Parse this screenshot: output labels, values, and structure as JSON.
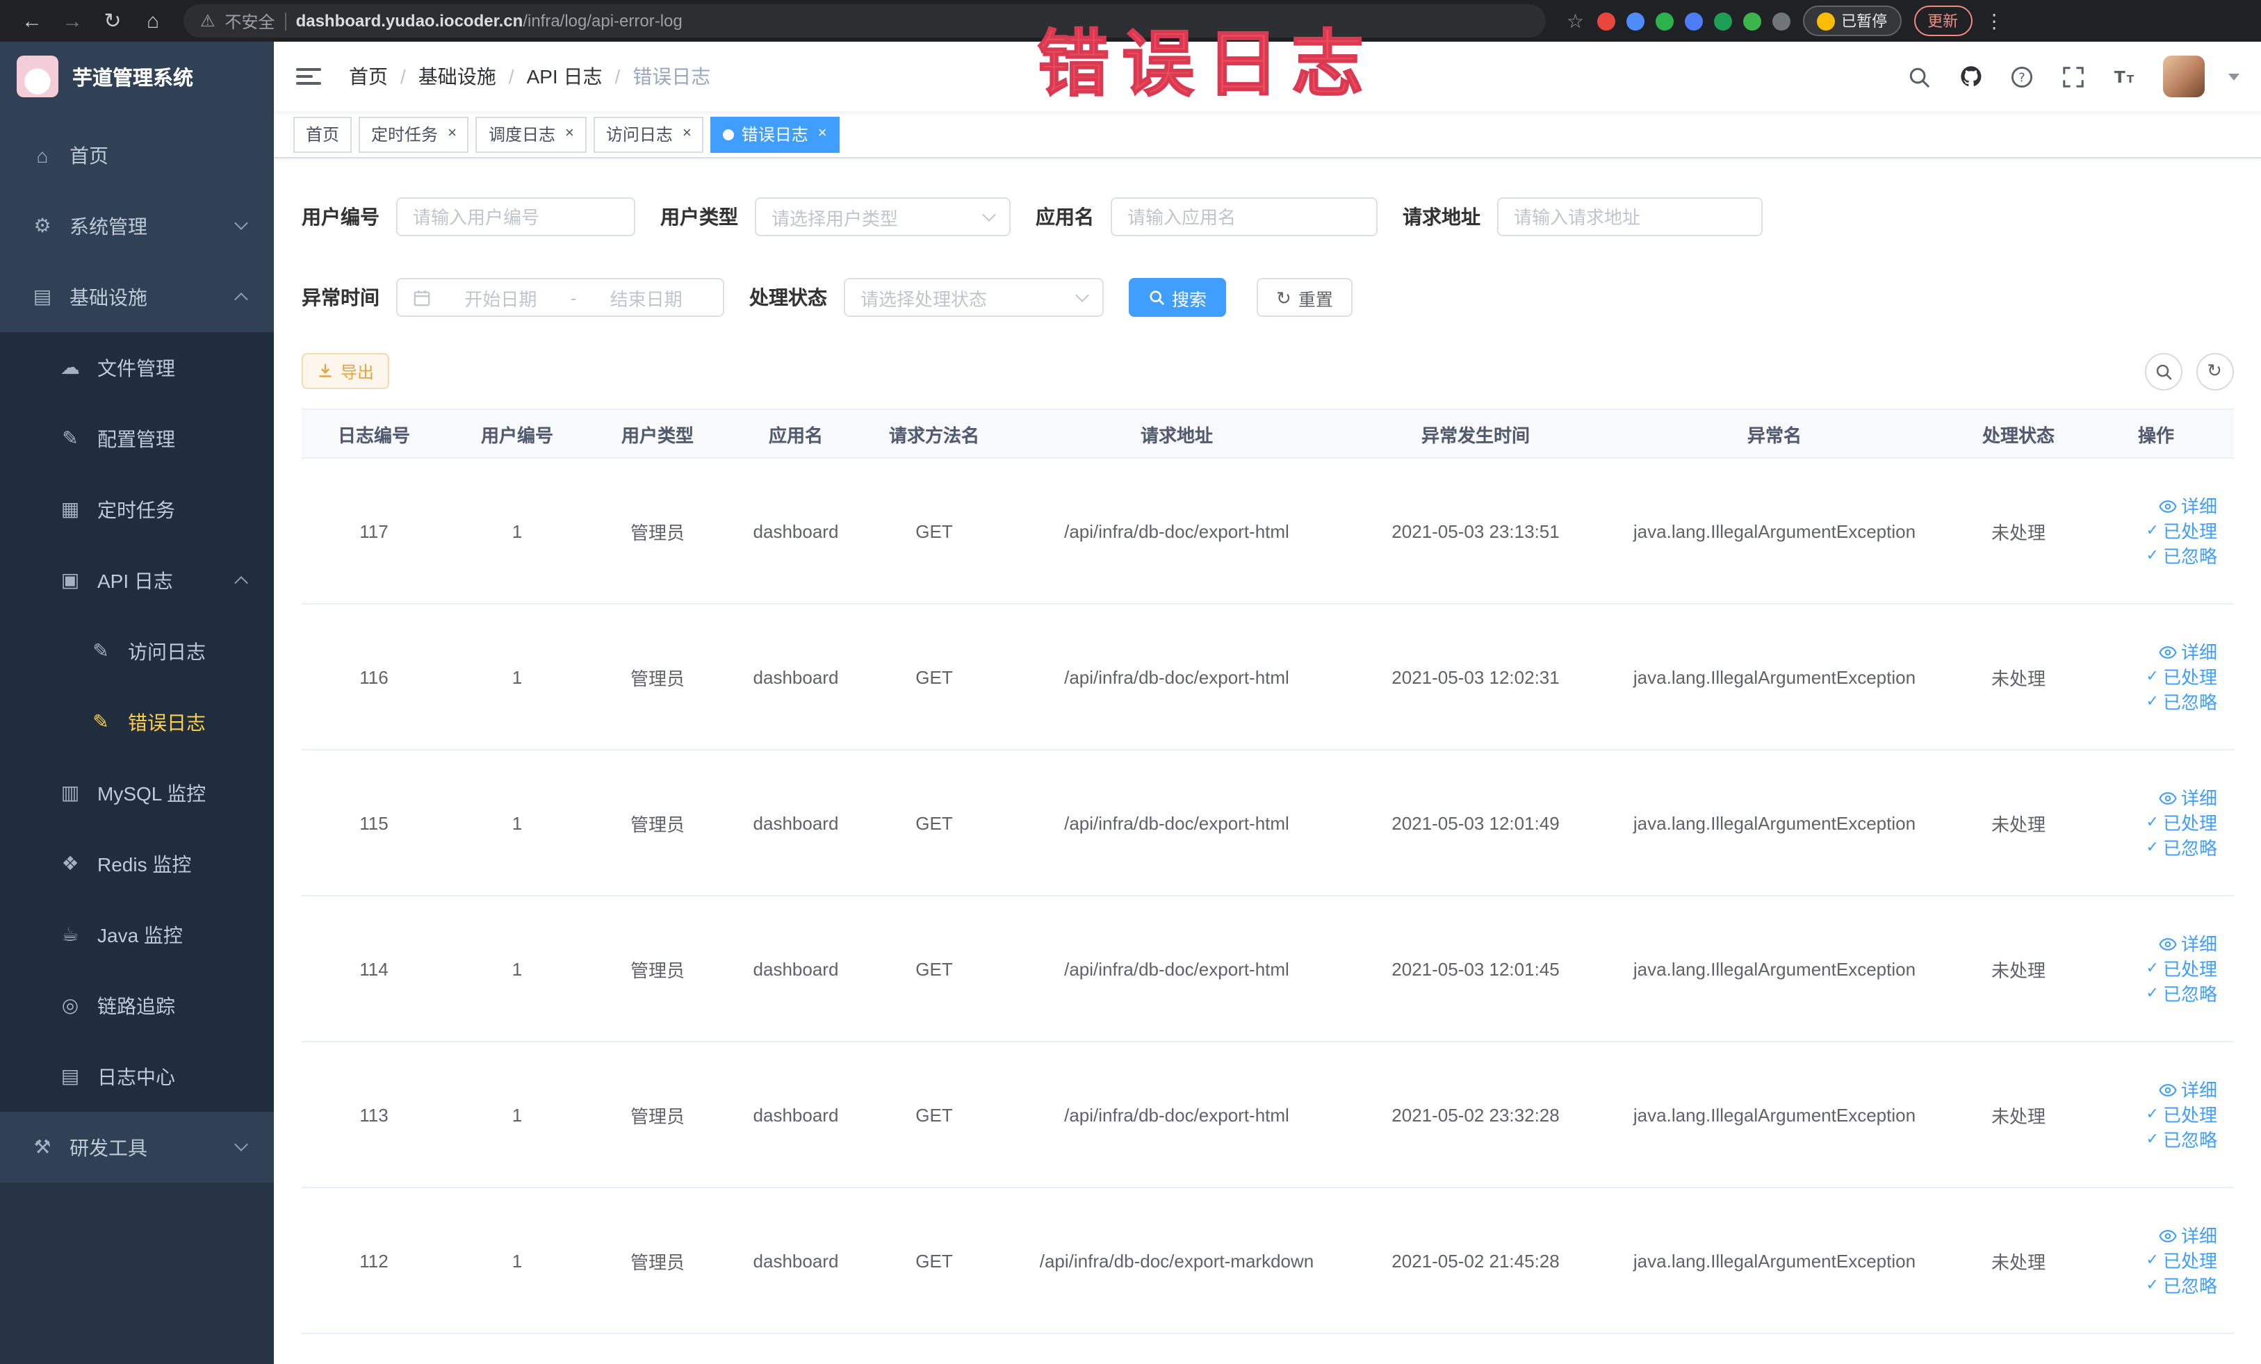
{
  "theme": {
    "primary": "#409eff",
    "menu_active": "#ffd04b",
    "sidebar_bg": "#304156",
    "submenu_bg": "#1f2d3d",
    "sidebar_bottom": "#263445",
    "warning_text": "#e6a23c",
    "warning_bg": "#fdf6ec",
    "warning_border": "#f5dab1",
    "annotation": "#ef4b5f"
  },
  "browser": {
    "security_label": "不安全",
    "url_host": "dashboard.yudao.iocoder.cn",
    "url_path": "/infra/log/api-error-log",
    "paused_label": "已暂停",
    "update_label": "更新",
    "extension_colors": [
      "#e8453c",
      "#4e8cf9",
      "#2bb24c",
      "#4e7df9",
      "#1e9e55",
      "#3cb54a",
      "#70757a"
    ]
  },
  "annotation": {
    "text": "错误日志"
  },
  "sidebar": {
    "title": "芋道管理系统",
    "items": [
      {
        "name": "home",
        "label": "首页",
        "icon": "home-icon",
        "level": 0,
        "chevron": "none",
        "active": false
      },
      {
        "name": "system-mgmt",
        "label": "系统管理",
        "icon": "gear-icon",
        "level": 0,
        "chevron": "down",
        "active": false
      },
      {
        "name": "infrastructure",
        "label": "基础设施",
        "icon": "infra-icon",
        "level": 0,
        "chevron": "up",
        "active": false
      },
      {
        "name": "file-mgmt",
        "label": "文件管理",
        "icon": "file-icon",
        "level": 1,
        "chevron": "none",
        "active": false
      },
      {
        "name": "config-mgmt",
        "label": "配置管理",
        "icon": "config-icon",
        "level": 1,
        "chevron": "none",
        "active": false
      },
      {
        "name": "scheduled-jobs",
        "label": "定时任务",
        "icon": "timer-icon",
        "level": 1,
        "chevron": "none",
        "active": false
      },
      {
        "name": "api-log",
        "label": "API 日志",
        "icon": "api-log-icon",
        "level": 1,
        "chevron": "up",
        "active": false
      },
      {
        "name": "access-log",
        "label": "访问日志",
        "icon": "access-log-icon",
        "level": 2,
        "chevron": "none",
        "active": false
      },
      {
        "name": "error-log",
        "label": "错误日志",
        "icon": "error-log-icon",
        "level": 2,
        "chevron": "none",
        "active": true
      },
      {
        "name": "mysql-monitor",
        "label": "MySQL 监控",
        "icon": "mysql-icon",
        "level": 1,
        "chevron": "none",
        "active": false
      },
      {
        "name": "redis-monitor",
        "label": "Redis 监控",
        "icon": "redis-icon",
        "level": 1,
        "chevron": "none",
        "active": false
      },
      {
        "name": "java-monitor",
        "label": "Java 监控",
        "icon": "java-icon",
        "level": 1,
        "chevron": "none",
        "active": false
      },
      {
        "name": "link-trace",
        "label": "链路追踪",
        "icon": "trace-icon",
        "level": 1,
        "chevron": "none",
        "active": false
      },
      {
        "name": "log-center",
        "label": "日志中心",
        "icon": "log-center-icon",
        "level": 1,
        "chevron": "none",
        "active": false
      },
      {
        "name": "dev-tools",
        "label": "研发工具",
        "icon": "tools-icon",
        "level": 0,
        "chevron": "down",
        "active": false
      }
    ]
  },
  "icon_glyphs": {
    "home-icon": "⌂",
    "gear-icon": "⚙",
    "infra-icon": "▤",
    "file-icon": "☁",
    "config-icon": "✎",
    "timer-icon": "▦",
    "api-log-icon": "▣",
    "access-log-icon": "✎",
    "error-log-icon": "✎",
    "mysql-icon": "▥",
    "redis-icon": "❖",
    "java-icon": "☕",
    "trace-icon": "◎",
    "log-center-icon": "▤",
    "tools-icon": "⚒"
  },
  "breadcrumb": [
    "首页",
    "基础设施",
    "API 日志",
    "错误日志"
  ],
  "tabs": [
    {
      "label": "首页",
      "closable": false,
      "active": false
    },
    {
      "label": "定时任务",
      "closable": true,
      "active": false
    },
    {
      "label": "调度日志",
      "closable": true,
      "active": false
    },
    {
      "label": "访问日志",
      "closable": true,
      "active": false
    },
    {
      "label": "错误日志",
      "closable": true,
      "active": true
    }
  ],
  "filters": {
    "user_id_label": "用户编号",
    "user_id_placeholder": "请输入用户编号",
    "user_type_label": "用户类型",
    "user_type_placeholder": "请选择用户类型",
    "app_name_label": "应用名",
    "app_name_placeholder": "请输入应用名",
    "request_url_label": "请求地址",
    "request_url_placeholder": "请输入请求地址",
    "exception_time_label": "异常时间",
    "date_start_placeholder": "开始日期",
    "date_separator": "-",
    "date_end_placeholder": "结束日期",
    "process_status_label": "处理状态",
    "process_status_placeholder": "请选择处理状态",
    "search_label": "搜索",
    "reset_label": "重置"
  },
  "toolbar": {
    "export_label": "导出"
  },
  "table": {
    "columns": [
      "日志编号",
      "用户编号",
      "用户类型",
      "应用名",
      "请求方法名",
      "请求地址",
      "异常发生时间",
      "异常名",
      "处理状态",
      "操作"
    ],
    "actions": [
      "详细",
      "已处理",
      "已忽略"
    ],
    "rows": [
      {
        "id": "117",
        "user_id": "1",
        "user_type": "管理员",
        "app": "dashboard",
        "method": "GET",
        "url": "/api/infra/db-doc/export-html",
        "time": "2021-05-03 23:13:51",
        "exception": "java.lang.IllegalArgumentException",
        "status": "未处理"
      },
      {
        "id": "116",
        "user_id": "1",
        "user_type": "管理员",
        "app": "dashboard",
        "method": "GET",
        "url": "/api/infra/db-doc/export-html",
        "time": "2021-05-03 12:02:31",
        "exception": "java.lang.IllegalArgumentException",
        "status": "未处理"
      },
      {
        "id": "115",
        "user_id": "1",
        "user_type": "管理员",
        "app": "dashboard",
        "method": "GET",
        "url": "/api/infra/db-doc/export-html",
        "time": "2021-05-03 12:01:49",
        "exception": "java.lang.IllegalArgumentException",
        "status": "未处理"
      },
      {
        "id": "114",
        "user_id": "1",
        "user_type": "管理员",
        "app": "dashboard",
        "method": "GET",
        "url": "/api/infra/db-doc/export-html",
        "time": "2021-05-03 12:01:45",
        "exception": "java.lang.IllegalArgumentException",
        "status": "未处理"
      },
      {
        "id": "113",
        "user_id": "1",
        "user_type": "管理员",
        "app": "dashboard",
        "method": "GET",
        "url": "/api/infra/db-doc/export-html",
        "time": "2021-05-02 23:32:28",
        "exception": "java.lang.IllegalArgumentException",
        "status": "未处理"
      },
      {
        "id": "112",
        "user_id": "1",
        "user_type": "管理员",
        "app": "dashboard",
        "method": "GET",
        "url": "/api/infra/db-doc/export-markdown",
        "time": "2021-05-02 21:45:28",
        "exception": "java.lang.IllegalArgumentException",
        "status": "未处理"
      }
    ]
  }
}
